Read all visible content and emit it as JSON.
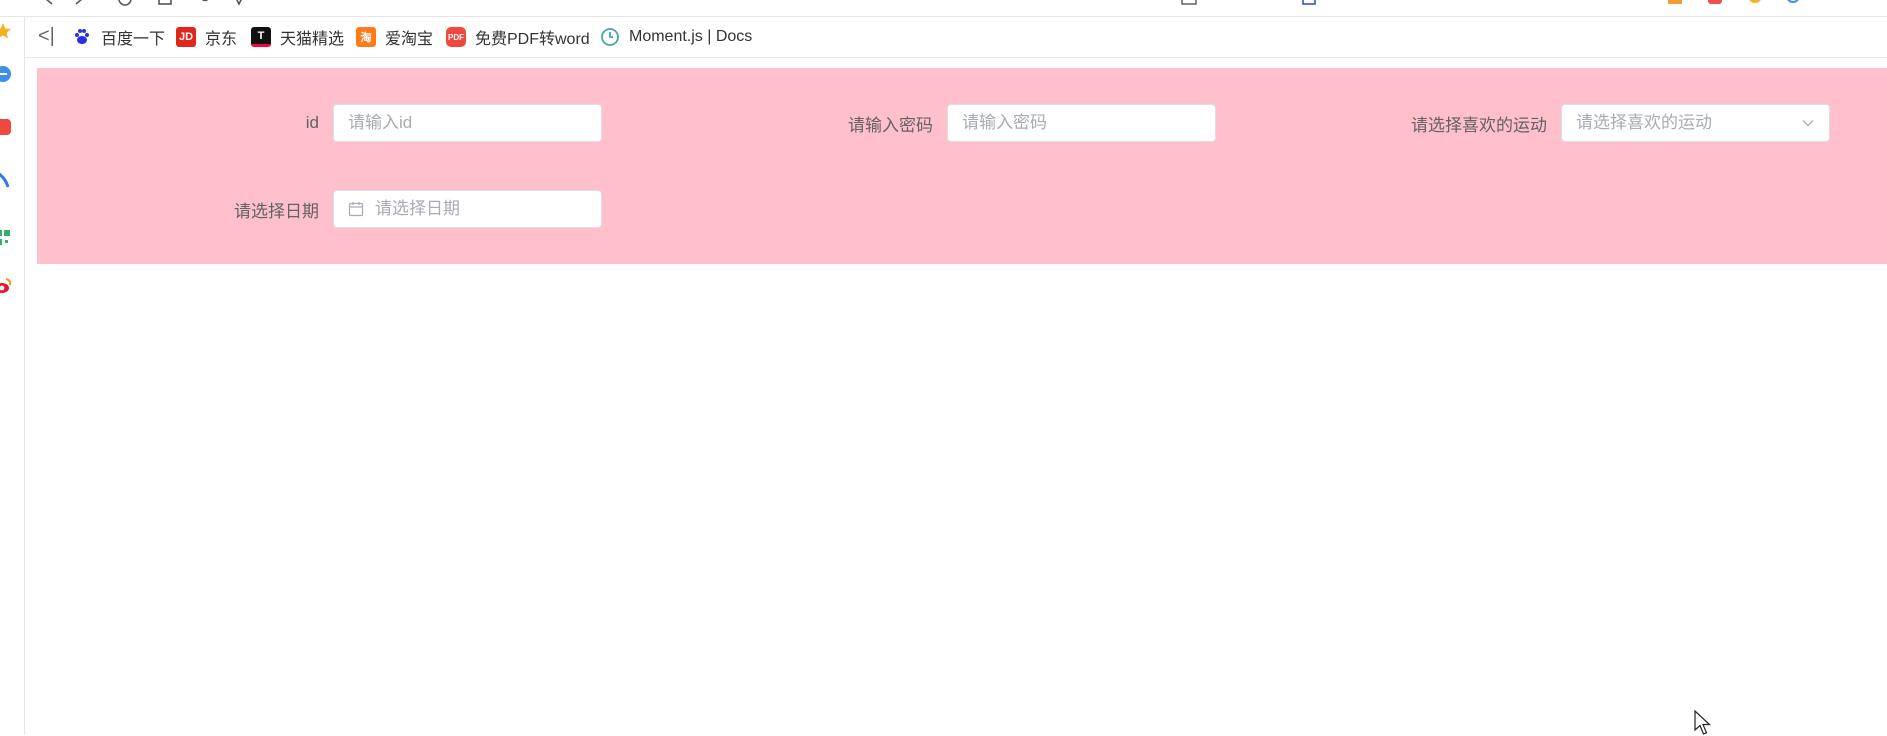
{
  "bookmarks": {
    "items": [
      {
        "label": "百度一下",
        "icon": "baidu-paw-icon",
        "color": "#2932e1"
      },
      {
        "label": "京东",
        "icon": "jd-logo-icon",
        "color": "#e1251b"
      },
      {
        "label": "天猫精选",
        "icon": "tmall-logo-icon",
        "color": "#ff0036"
      },
      {
        "label": "爱淘宝",
        "icon": "taobao-logo-icon",
        "color": "#ff5000"
      },
      {
        "label": "免费PDF转word",
        "icon": "pdf-icon",
        "color": "#f0483e"
      },
      {
        "label": "Moment.js | Docs",
        "icon": "clock-icon",
        "color": "#4aa5a5"
      }
    ]
  },
  "form": {
    "background": "#ffc0cb",
    "id": {
      "label": "id",
      "placeholder": "请输入id"
    },
    "password": {
      "label": "请输入密码",
      "placeholder": "请输入密码"
    },
    "sport": {
      "label": "请选择喜欢的运动",
      "placeholder": "请选择喜欢的运动"
    },
    "date": {
      "label": "请选择日期",
      "placeholder": "请选择日期"
    }
  }
}
